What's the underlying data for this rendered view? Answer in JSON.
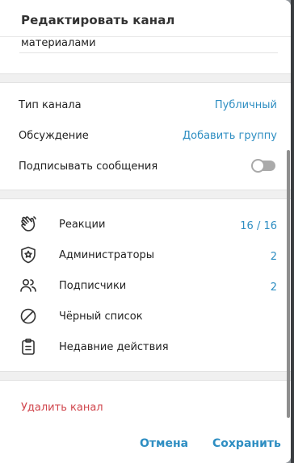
{
  "dialog": {
    "title": "Редактировать канал",
    "description_value": "материалами"
  },
  "settings": {
    "channel_type_label": "Тип канала",
    "channel_type_value": "Публичный",
    "discussion_label": "Обсуждение",
    "discussion_value": "Добавить группу",
    "sign_messages_label": "Подписывать сообщения",
    "sign_messages_enabled": false
  },
  "manage": {
    "items": [
      {
        "label": "Реакции",
        "value": "16 / 16",
        "icon": "hand-wave-icon"
      },
      {
        "label": "Администраторы",
        "value": "2",
        "icon": "admin-shield-icon"
      },
      {
        "label": "Подписчики",
        "value": "2",
        "icon": "subscribers-icon"
      },
      {
        "label": "Чёрный список",
        "value": "",
        "icon": "block-icon"
      },
      {
        "label": "Недавние действия",
        "value": "",
        "icon": "clipboard-icon"
      }
    ]
  },
  "actions": {
    "delete_label": "Удалить канал",
    "cancel_label": "Отмена",
    "save_label": "Сохранить"
  },
  "colors": {
    "accent": "#2e8ec2",
    "danger": "#d0454c"
  }
}
